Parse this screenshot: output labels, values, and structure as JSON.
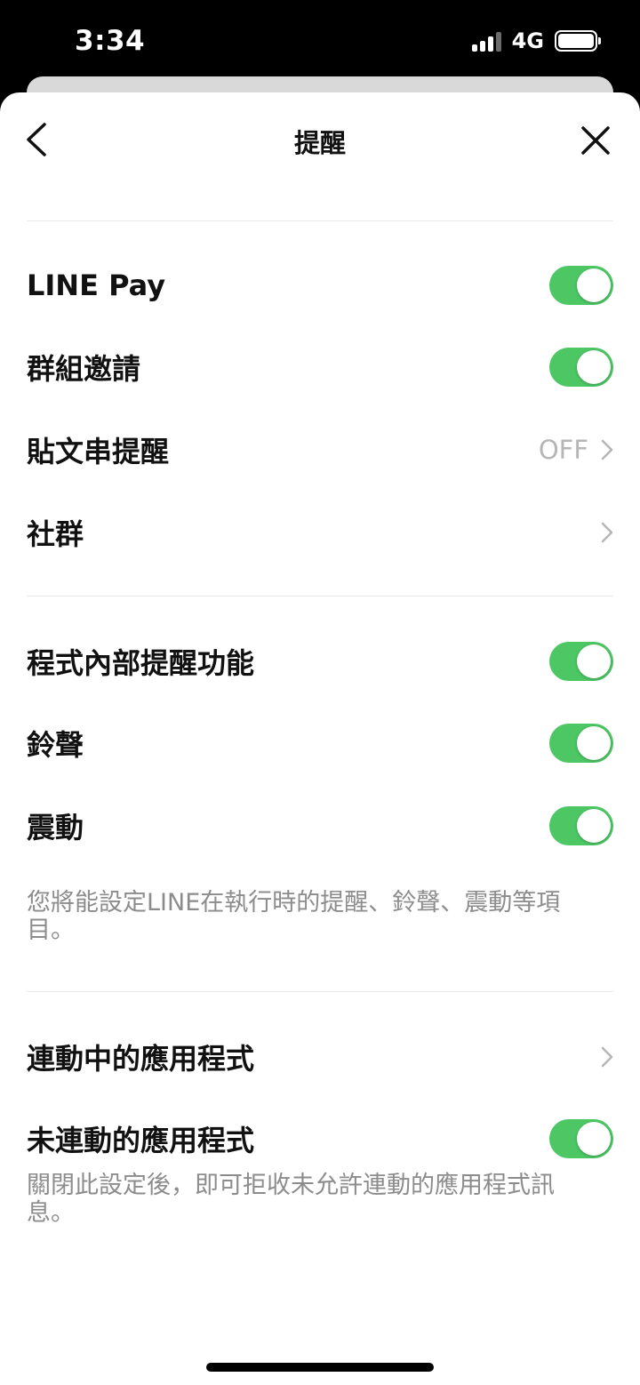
{
  "status_bar": {
    "time": "3:34",
    "network": "4G",
    "icons": [
      "signal-icon",
      "battery-icon"
    ]
  },
  "header": {
    "title": "提醒",
    "back_icon": "chevron-left-icon",
    "close_icon": "close-icon"
  },
  "section1": {
    "line_pay": {
      "label": "LINE Pay",
      "toggle_on": true
    },
    "group_invite": {
      "label": "群組邀請",
      "toggle_on": true
    },
    "post_reminder": {
      "label": "貼文串提醒",
      "value": "OFF"
    },
    "community": {
      "label": "社群"
    }
  },
  "section2": {
    "in_app": {
      "label": "程式內部提醒功能",
      "toggle_on": true
    },
    "sound": {
      "label": "鈴聲",
      "toggle_on": true
    },
    "vibration": {
      "label": "震動",
      "toggle_on": true
    },
    "note": "您將能設定LINE在執行時的提醒、鈴聲、震動等項目。"
  },
  "section3": {
    "linked_apps": {
      "label": "連動中的應用程式"
    },
    "unlinked_apps": {
      "label": "未連動的應用程式",
      "toggle_on": true
    },
    "note": "關閉此設定後，即可拒收未允許連動的應用程式訊息。"
  },
  "colors": {
    "toggle_on": "#4cc764",
    "secondary_text": "#8c8c8c",
    "value_text": "#b6b6b6"
  }
}
